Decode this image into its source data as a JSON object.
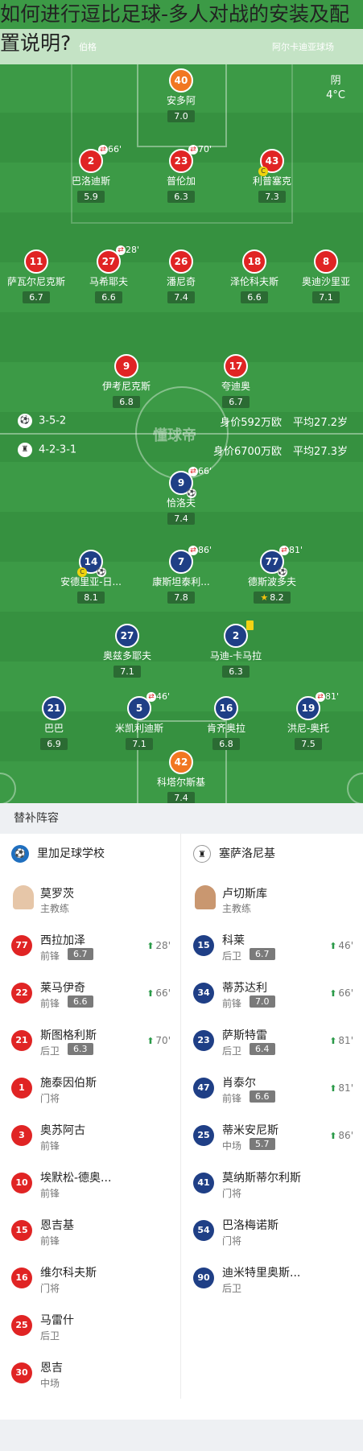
{
  "headline": {
    "line1": "如何进行逗比足球-多人对战的安装及配",
    "line2": "置说明?"
  },
  "topbar": {
    "home_tag": "伯格",
    "away_tag": "阿尔卡迪亚球场"
  },
  "weather": {
    "condition": "阴",
    "temp": "4°C"
  },
  "watermark": "懂球帝",
  "formations": {
    "home": {
      "formation": "3-5-2",
      "value": "身价592万欧",
      "age": "平均27.2岁"
    },
    "away": {
      "formation": "4-2-3-1",
      "value": "身价6700万欧",
      "age": "平均27.3岁"
    }
  },
  "home_players": [
    {
      "num": "40",
      "name": "安多阿",
      "rating": "7.0",
      "kit": "orange"
    },
    {
      "num": "2",
      "name": "巴洛迪斯",
      "rating": "5.9",
      "kit": "red",
      "sub": "66'"
    },
    {
      "num": "23",
      "name": "普伦加",
      "rating": "6.3",
      "kit": "red",
      "sub": "70'"
    },
    {
      "num": "43",
      "name": "利普塞克",
      "rating": "7.3",
      "kit": "red",
      "cap": "C"
    },
    {
      "num": "11",
      "name": "萨瓦尔尼克斯",
      "rating": "6.7",
      "kit": "red"
    },
    {
      "num": "27",
      "name": "马希耶夫",
      "rating": "6.6",
      "kit": "red",
      "sub": "28'"
    },
    {
      "num": "26",
      "name": "潘尼奇",
      "rating": "7.4",
      "kit": "red"
    },
    {
      "num": "18",
      "name": "泽伦科夫斯",
      "rating": "6.6",
      "kit": "red"
    },
    {
      "num": "8",
      "name": "奥迪沙里亚",
      "rating": "7.1",
      "kit": "red"
    },
    {
      "num": "9",
      "name": "伊考尼克斯",
      "rating": "6.8",
      "kit": "red"
    },
    {
      "num": "17",
      "name": "夸迪奥",
      "rating": "6.7",
      "kit": "red"
    }
  ],
  "away_players": [
    {
      "num": "9",
      "name": "恰洛夫",
      "rating": "7.4",
      "kit": "navy",
      "sub": "66'",
      "ball": "⚽"
    },
    {
      "num": "14",
      "name": "安德里亚-日...",
      "rating": "8.1",
      "kit": "navy",
      "cap": "C",
      "ball": "⚽"
    },
    {
      "num": "7",
      "name": "康斯坦泰利...",
      "rating": "7.8",
      "kit": "navy",
      "sub": "86'"
    },
    {
      "num": "77",
      "name": "德斯波多夫",
      "rating": "8.2",
      "kit": "navy",
      "sub": "81'",
      "ball": "⚽",
      "star": "★"
    },
    {
      "num": "27",
      "name": "奥兹多耶夫",
      "rating": "7.1",
      "kit": "navy"
    },
    {
      "num": "2",
      "name": "马迪-卡马拉",
      "rating": "6.3",
      "kit": "navy"
    },
    {
      "num": "21",
      "name": "巴巴",
      "rating": "6.9",
      "kit": "navy"
    },
    {
      "num": "5",
      "name": "米凯利迪斯",
      "rating": "7.1",
      "kit": "navy",
      "sub": "46'"
    },
    {
      "num": "16",
      "name": "肯齐奥拉",
      "rating": "6.8",
      "kit": "navy"
    },
    {
      "num": "19",
      "name": "洪尼-奥托",
      "rating": "7.5",
      "kit": "navy",
      "sub": "81'"
    },
    {
      "num": "42",
      "name": "科塔尔斯基",
      "rating": "7.4",
      "kit": "orange"
    }
  ],
  "subs": {
    "title": "替补阵容",
    "home_team": "里加足球学校",
    "away_team": "塞萨洛尼基",
    "home_coach": {
      "name": "莫罗茨",
      "role": "主教练"
    },
    "away_coach": {
      "name": "卢切斯库",
      "role": "主教练"
    },
    "home_list": [
      {
        "num": "77",
        "name": "西拉加泽",
        "pos": "前锋",
        "rating": "6.7",
        "time": "28'"
      },
      {
        "num": "22",
        "name": "莱马伊奇",
        "pos": "前锋",
        "rating": "6.6",
        "time": "66'"
      },
      {
        "num": "21",
        "name": "斯图格利斯",
        "pos": "后卫",
        "rating": "6.3",
        "time": "70'"
      },
      {
        "num": "1",
        "name": "施泰因伯斯",
        "pos": "门将"
      },
      {
        "num": "3",
        "name": "奥苏阿古",
        "pos": "前锋"
      },
      {
        "num": "10",
        "name": "埃默松-德奥...",
        "pos": "前锋"
      },
      {
        "num": "15",
        "name": "恩吉基",
        "pos": "前锋"
      },
      {
        "num": "16",
        "name": "维尔科夫斯",
        "pos": "门将"
      },
      {
        "num": "25",
        "name": "马雷什",
        "pos": "后卫"
      },
      {
        "num": "30",
        "name": "恩吉",
        "pos": "中场"
      }
    ],
    "away_list": [
      {
        "num": "15",
        "name": "科莱",
        "pos": "后卫",
        "rating": "6.7",
        "time": "46'"
      },
      {
        "num": "34",
        "name": "蒂苏达利",
        "pos": "前锋",
        "rating": "7.0",
        "time": "66'"
      },
      {
        "num": "23",
        "name": "萨斯特雷",
        "pos": "后卫",
        "rating": "6.4",
        "time": "81'"
      },
      {
        "num": "47",
        "name": "肖泰尔",
        "pos": "前锋",
        "rating": "6.6",
        "time": "81'"
      },
      {
        "num": "25",
        "name": "蒂米安尼斯",
        "pos": "中场",
        "rating": "5.7",
        "time": "86'"
      },
      {
        "num": "41",
        "name": "莫纳斯蒂尔利斯",
        "pos": "门将"
      },
      {
        "num": "54",
        "name": "巴洛梅诺斯",
        "pos": "门将"
      },
      {
        "num": "90",
        "name": "迪米特里奥斯...",
        "pos": "后卫"
      }
    ]
  }
}
